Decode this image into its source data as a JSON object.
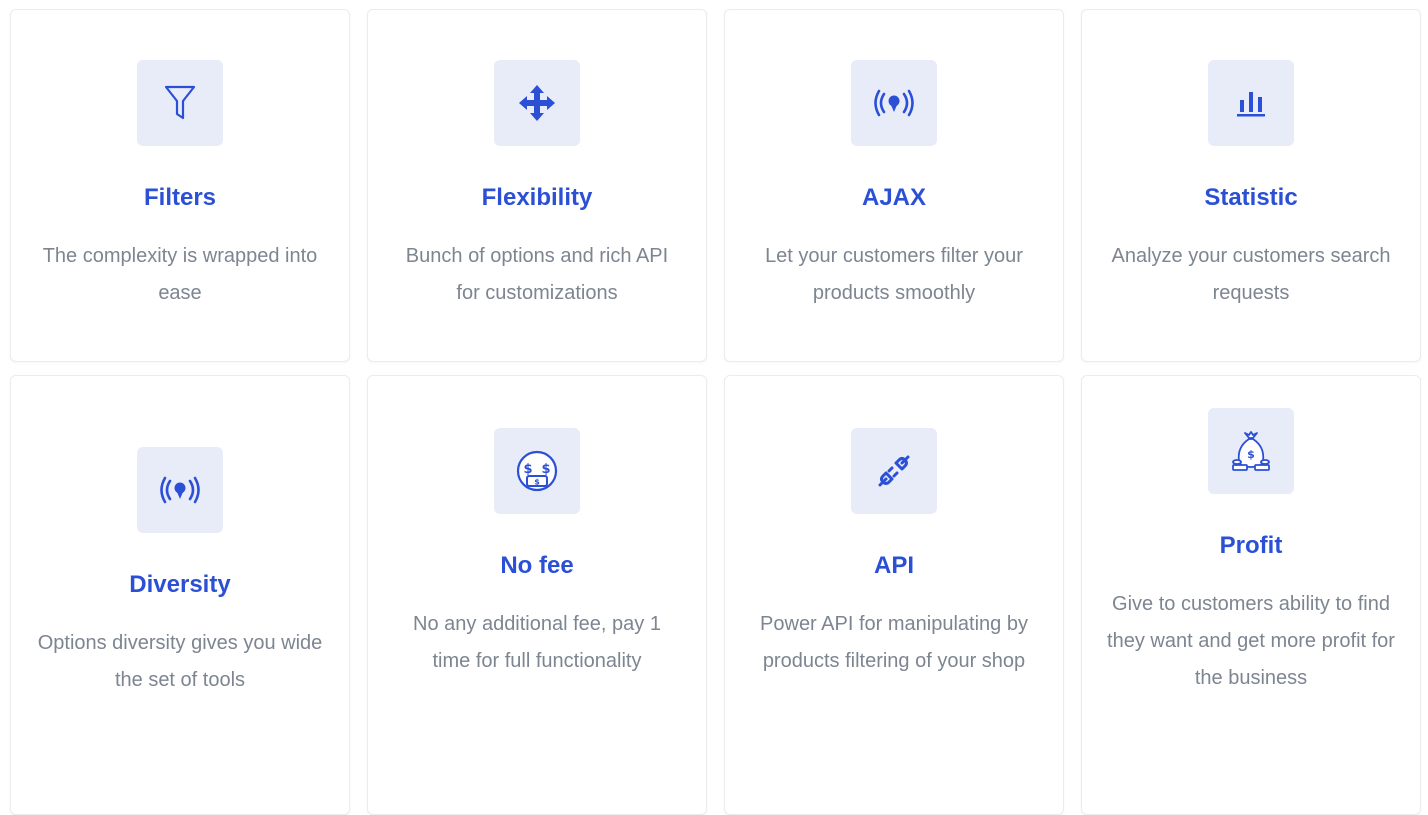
{
  "features": [
    {
      "icon": "filter-icon",
      "title": "Filters",
      "desc": "The complexity is wrapped into ease"
    },
    {
      "icon": "move-arrows-icon",
      "title": "Flexibility",
      "desc": "Bunch of options and rich API for customizations"
    },
    {
      "icon": "broadcast-icon",
      "title": "AJAX",
      "desc": "Let your customers filter your products smoothly"
    },
    {
      "icon": "bar-chart-icon",
      "title": "Statistic",
      "desc": "Analyze your customers search requests"
    },
    {
      "icon": "broadcast-icon",
      "title": "Diversity",
      "desc": "Options diversity gives you wide the set of tools"
    },
    {
      "icon": "money-face-icon",
      "title": "No fee",
      "desc": "No any additional fee, pay 1 time for full functionality"
    },
    {
      "icon": "plug-icon",
      "title": "API",
      "desc": "Power API for manipulating by products filtering of your shop"
    },
    {
      "icon": "money-bag-icon",
      "title": "Profit",
      "desc": "Give to customers ability to find they want and get more profit for the business"
    }
  ],
  "colors": {
    "accent": "#2b50d6",
    "icon_bg": "#e8ecf9",
    "text_muted": "#7d8591"
  }
}
